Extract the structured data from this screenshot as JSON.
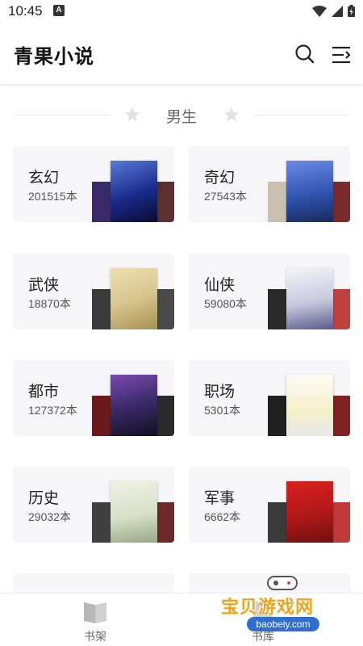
{
  "status": {
    "time": "10:45",
    "notification_glyph": "A"
  },
  "app": {
    "title": "青果小说",
    "search_icon": "search-icon",
    "menu_icon": "menu-icon"
  },
  "section": {
    "title": "男生"
  },
  "categories": [
    {
      "name": "玄幻",
      "count": "201515本",
      "cover_colors": [
        "#3a2a6a",
        "#1a2a8a",
        "#5a3030"
      ]
    },
    {
      "name": "奇幻",
      "count": "27543本",
      "cover_colors": [
        "#c8c0b0",
        "#2c4fa8",
        "#7a2a2a"
      ]
    },
    {
      "name": "武侠",
      "count": "18870本",
      "cover_colors": [
        "#3a3a3a",
        "#d8c690",
        "#4a4a4a"
      ]
    },
    {
      "name": "仙侠",
      "count": "59080本",
      "cover_colors": [
        "#2a2a2a",
        "#e8e8f0",
        "#c04040"
      ]
    },
    {
      "name": "都市",
      "count": "127372本",
      "cover_colors": [
        "#6a1a1a",
        "#3a2a6a",
        "#2a2a2a"
      ]
    },
    {
      "name": "职场",
      "count": "5301本",
      "cover_colors": [
        "#202020",
        "#f4f4f0",
        "#802020"
      ]
    },
    {
      "name": "历史",
      "count": "29032本",
      "cover_colors": [
        "#404040",
        "#d8e0c8",
        "#6a2a2a"
      ]
    },
    {
      "name": "军事",
      "count": "6662本",
      "cover_colors": [
        "#3a3a3a",
        "#b01818",
        "#c03a3a"
      ]
    }
  ],
  "bottom_nav": [
    {
      "label": "书架",
      "icon": "bookshelf-icon"
    },
    {
      "label": "书库",
      "icon": "library-icon"
    }
  ],
  "watermark": {
    "text": "宝贝游戏网",
    "url": "baobeiy.com"
  }
}
